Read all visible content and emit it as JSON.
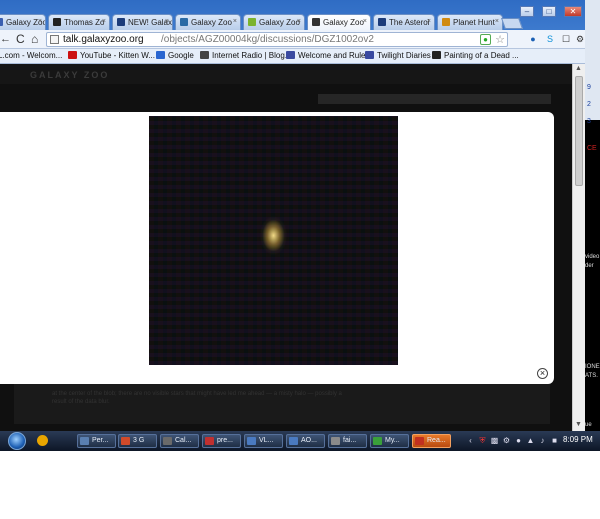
{
  "tabs": [
    {
      "label": "Galaxy Zoo",
      "icon": "galaxyzoo-icon",
      "color": "#3a5fb0"
    },
    {
      "label": "Thomas Zo",
      "icon": "my-icon",
      "color": "#222222"
    },
    {
      "label": "NEW! Galax",
      "icon": "bird-icon",
      "color": "#1c3c7a"
    },
    {
      "label": "Galaxy Zoo",
      "icon": "wordpress-icon",
      "color": "#2a6aa5"
    },
    {
      "label": "Galaxy Zoo",
      "icon": "green-tile-icon",
      "color": "#7bb32e"
    },
    {
      "label": "Galaxy Zoo",
      "icon": "talk-icon",
      "color": "#333333",
      "active": true
    },
    {
      "label": "The Asteroi",
      "icon": "bird-icon",
      "color": "#1c3c7a"
    },
    {
      "label": "Planet Hunt",
      "icon": "planet-icon",
      "color": "#d08a10"
    }
  ],
  "window_controls": {
    "minimize": "–",
    "restore": "□",
    "close": "✕"
  },
  "toolbar": {
    "back": "←",
    "reload": "C",
    "home": "⌂",
    "url_host": "talk.galaxyzoo.org",
    "url_path": "/objects/AGZ00004kg/discussions/DGZ1002ov2"
  },
  "bookmarks": [
    {
      "label": "L.com - Welcom...",
      "color": "#1c4f9c"
    },
    {
      "label": "YouTube - Kitten W...",
      "color": "#cc1111"
    },
    {
      "label": "Google",
      "color": "#2a66d0"
    },
    {
      "label": "Internet Radio | Blog...",
      "color": "#444444"
    },
    {
      "label": "Welcome and Rules",
      "color": "#3a4aa0"
    },
    {
      "label": "Twilight Diaries",
      "color": "#3a4aa0"
    },
    {
      "label": "Painting of a Dead ...",
      "color": "#222222"
    }
  ],
  "page": {
    "logo": "GALAXY ZOO",
    "footer_text": "at the center of the blob; there are no visible stars that might have led me ahead — a misty halo — possibly a result of the data blur."
  },
  "lightbox": {
    "image_alt": "galaxy-thumbnail",
    "close": "×"
  },
  "behind_window": {
    "items": [
      "9",
      "2",
      "3",
      "CE"
    ],
    "texts": [
      "video",
      "der",
      "IONE",
      "ATS.",
      "ue"
    ]
  },
  "taskbar": {
    "items": [
      {
        "label": "Per...",
        "color": "#5a7fb0"
      },
      {
        "label": "3 G",
        "color": "#d04a2a"
      },
      {
        "label": "Cal...",
        "color": "#6a6a6a"
      },
      {
        "label": "pre...",
        "color": "#c03030"
      },
      {
        "label": "VL...",
        "color": "#4a7ac0"
      },
      {
        "label": "AO...",
        "color": "#4a7ac0"
      },
      {
        "label": "fai...",
        "color": "#8a8a8a"
      },
      {
        "label": "My...",
        "color": "#3aa03a"
      },
      {
        "label": "Rea...",
        "color": "#c03020",
        "active": true
      }
    ],
    "clock": "8:09 PM"
  }
}
